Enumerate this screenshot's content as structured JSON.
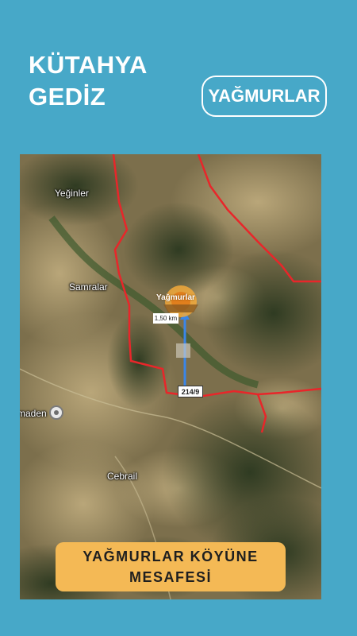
{
  "header": {
    "line1": "KÜTAHYA",
    "line2": "GEDİZ",
    "village": "YAĞMURLAR"
  },
  "map": {
    "places": {
      "yeginler": "Yeğinler",
      "samralar": "Samralar",
      "cebrail": "Cebrail",
      "maden": "maden"
    },
    "distance_label": "1,50 km",
    "road_label": "214/9",
    "logo_text": "Yağmurlar",
    "colors": {
      "boundary": "#e8262a",
      "route": "#3a86e8",
      "terrain_light": "#9c8a62",
      "terrain_dark": "#4a4a32",
      "forest": "#3b4a2c"
    }
  },
  "caption": {
    "line1": "YAĞMURLAR KÖYÜNE",
    "line2": "MESAFESİ"
  }
}
